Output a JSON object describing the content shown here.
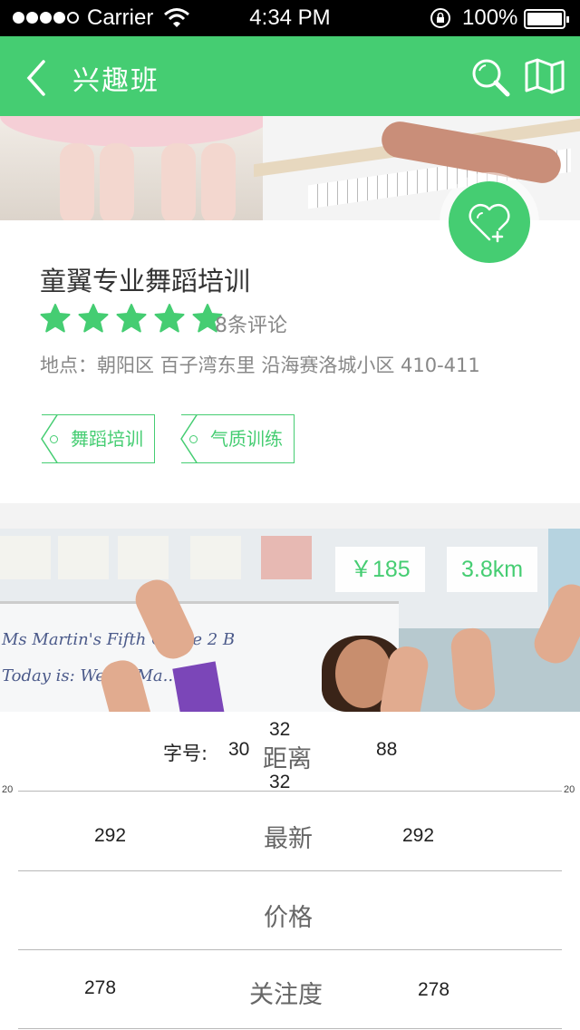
{
  "status_bar": {
    "carrier": "Carrier",
    "time": "4:34 PM",
    "battery": "100%"
  },
  "nav": {
    "title": "兴趣班",
    "back_icon": "chevron-left-icon",
    "search_icon": "search-icon",
    "map_icon": "map-icon",
    "color": "#45cd72"
  },
  "listing": {
    "name": "童翼专业舞蹈培训",
    "stars": 5,
    "reviews": "8条评论",
    "address": "地点：朝阳区 百子湾东里 沿海赛洛城小区 410-411",
    "tags": [
      "舞蹈培训",
      "气质训练"
    ]
  },
  "second_listing": {
    "price": "￥185",
    "distance": "3.8km",
    "board_line1": "Ms Martin's Fifth Grade 2 B",
    "board_line2": "Today is: Wed... Ma..."
  },
  "picker": {
    "font_label": "字号:",
    "font_size": "30",
    "size_above": "32",
    "size_below": "32",
    "size_right": "88",
    "edge_left": "20",
    "edge_right": "20",
    "options": [
      {
        "label": "距离",
        "left_num": "",
        "right_num": ""
      },
      {
        "label": "最新",
        "left_num": "292",
        "right_num": "292"
      },
      {
        "label": "价格",
        "left_num": "",
        "right_num": ""
      },
      {
        "label": "关注度",
        "left_num": "278",
        "right_num": "278"
      }
    ]
  }
}
